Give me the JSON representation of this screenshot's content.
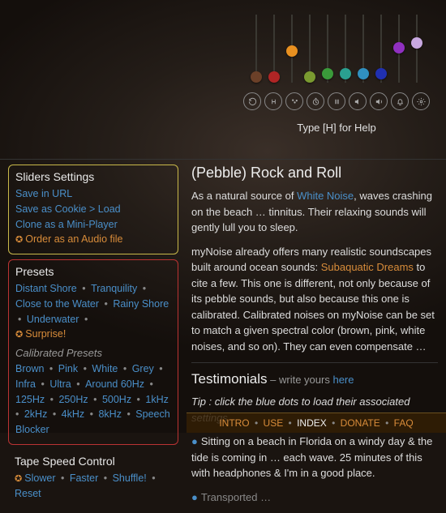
{
  "sliders": [
    {
      "color": "#6b4028",
      "pos": 70
    },
    {
      "color": "#b02525",
      "pos": 70
    },
    {
      "color": "#e89020",
      "pos": 38
    },
    {
      "color": "#7a9a30",
      "pos": 70
    },
    {
      "color": "#3a9a3a",
      "pos": 66
    },
    {
      "color": "#2aa090",
      "pos": 66
    },
    {
      "color": "#3090c0",
      "pos": 66
    },
    {
      "color": "#2030b0",
      "pos": 66
    },
    {
      "color": "#9030c0",
      "pos": 34
    },
    {
      "color": "#c8a8e0",
      "pos": 28
    }
  ],
  "help": "Type [H] for Help",
  "panels": {
    "sliders": {
      "title": "Sliders Settings",
      "save_url": "Save in URL",
      "save_cookie": "Save as Cookie > Load",
      "clone": "Clone as a Mini-Player",
      "order": "Order as an Audio file"
    },
    "presets": {
      "title": "Presets",
      "row1": [
        "Distant Shore",
        "Tranquility",
        "Close to the Water",
        "Rainy Shore",
        "Underwater"
      ],
      "surprise": "Surprise!",
      "cal_title": "Calibrated Presets",
      "cal": [
        "Brown",
        "Pink",
        "White",
        "Grey",
        "Infra",
        "Ultra",
        "Around 60Hz",
        "125Hz",
        "250Hz",
        "500Hz",
        "1kHz",
        "2kHz",
        "4kHz",
        "8kHz",
        "Speech Blocker"
      ]
    },
    "tape": {
      "title": "Tape Speed Control",
      "items": [
        "Slower",
        "Faster",
        "Shuffle!",
        "Reset"
      ]
    }
  },
  "main": {
    "title": "(Pebble) Rock and Roll",
    "p1a": "As a natural source of ",
    "wn": "White Noise",
    "p1b": ", waves crashing on the beach … tinnitus. Their relaxing sounds will gently lull you to sleep.",
    "p2a": "myNoise already offers many realistic soundscapes built around ocean sounds: ",
    "sd": "Subaquatic Dreams",
    "p2b": " to cite a few. This one is different, not only because of its pebble sounds, but also because this one is calibrated. Calibrated noises on myNoise can be set to match a given spectral color (brown, pink, white noises, and so on). They can even compensate …",
    "test_title": "Testimonials",
    "test_sub": " – write yours ",
    "here": "here",
    "tip": "Tip : click the blue dots to load their associated settings.",
    "story": "Sitting on a beach in Florida on a windy day & the tide is coming in … each wave. 25 minutes of this with headphones & I'm in a good place.",
    "story2": "Transported …"
  },
  "footer": [
    "INTRO",
    "USE",
    "INDEX",
    "DONATE",
    "FAQ"
  ]
}
